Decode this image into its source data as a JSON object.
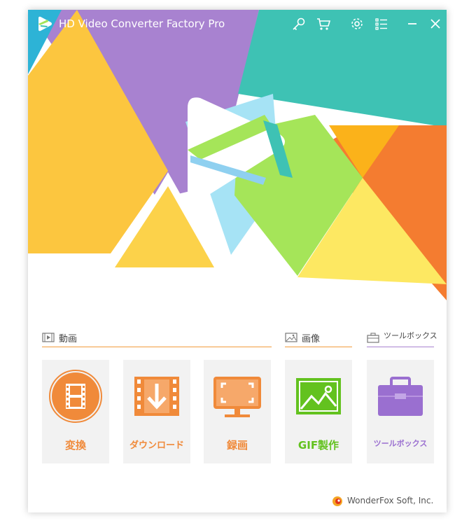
{
  "app": {
    "title": "HD Video Converter Factory Pro"
  },
  "titlebar": {
    "buttons": [
      {
        "name": "register-key-icon"
      },
      {
        "name": "shopping-cart-icon"
      },
      {
        "name": "settings-gear-icon"
      },
      {
        "name": "menu-list-icon"
      },
      {
        "name": "minimize-icon"
      },
      {
        "name": "close-icon"
      }
    ]
  },
  "sections": {
    "video": {
      "label": "動画",
      "icon": "film-strip-icon"
    },
    "image": {
      "label": "画像",
      "icon": "picture-icon"
    },
    "toolbox": {
      "label": "ツールボックス",
      "icon": "briefcase-icon"
    }
  },
  "tiles": [
    {
      "label": "変換",
      "icon": "convert-film-icon",
      "color": "#f08a3a"
    },
    {
      "label": "ダウンロード",
      "icon": "download-icon",
      "color": "#f08a3a"
    },
    {
      "label": "録画",
      "icon": "screen-record-icon",
      "color": "#f08a3a"
    },
    {
      "label": "GIF製作",
      "icon": "gif-image-icon",
      "color": "#63c21f"
    },
    {
      "label": "ツールボックス",
      "icon": "toolbox-icon",
      "color": "#9a6fd0"
    }
  ],
  "footer": {
    "company": "WonderFox Soft, Inc."
  },
  "colors": {
    "accent_orange": "#f39b3c",
    "hero_teal": "#3ec2b4",
    "hero_purple": "#a882d0",
    "hero_yellow": "#fcc63f",
    "hero_green": "#a5e559",
    "hero_orange": "#f47c30"
  }
}
